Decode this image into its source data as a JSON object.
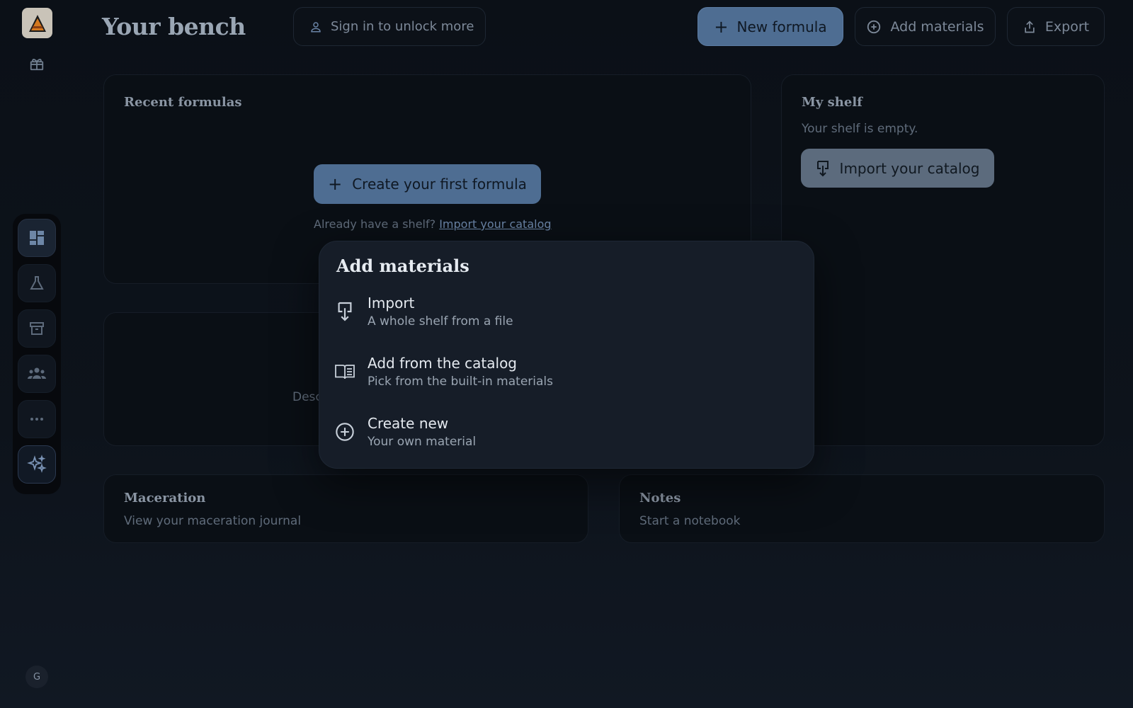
{
  "header": {
    "title": "Your bench",
    "signin_label": "Sign in to unlock more",
    "new_formula_label": "New formula",
    "add_materials_label": "Add materials",
    "export_label": "Export"
  },
  "sidebar": {
    "items": [
      "dashboard",
      "formulas",
      "archive",
      "community",
      "more",
      "assistant"
    ],
    "avatar_initial": "G"
  },
  "recent": {
    "title": "Recent formulas",
    "create_label": "Create your first formula",
    "already_text": "Already have a shelf?",
    "import_link": "Import your catalog"
  },
  "shelf": {
    "title": "My shelf",
    "empty_text": "Your shelf is empty.",
    "import_label": "Import your catalog"
  },
  "mid": {
    "partial_text": "Desc"
  },
  "maceration": {
    "title": "Maceration",
    "subtitle": "View your maceration journal"
  },
  "notes": {
    "title": "Notes",
    "subtitle": "Start a notebook"
  },
  "popup": {
    "title": "Add materials",
    "items": [
      {
        "title": "Import",
        "subtitle": "A whole shelf from a file"
      },
      {
        "title": "Add from the catalog",
        "subtitle": "Pick from the built-in materials"
      },
      {
        "title": "Create new",
        "subtitle": "Your own material"
      }
    ]
  },
  "colors": {
    "accent": "#4e6d92",
    "background": "#0b1017",
    "popup": "#161d28"
  }
}
